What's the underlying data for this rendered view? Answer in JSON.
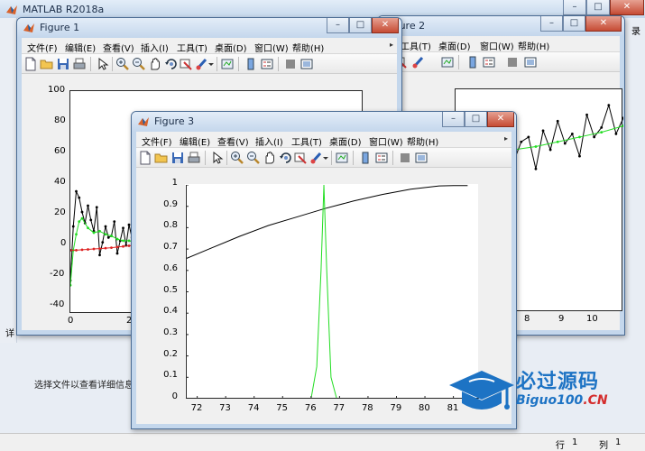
{
  "app": {
    "title": "MATLAB R2018a",
    "controls": {
      "minimize": "–",
      "maximize": "□",
      "close": "✕"
    },
    "side_text": "录",
    "browser_truncated": "详",
    "browser_hint": "选择文件以查看详细信息",
    "status": {
      "row_label": "行",
      "row_value": "1",
      "col_label": "列",
      "col_value": "1"
    }
  },
  "menus": [
    "文件(F)",
    "编辑(E)",
    "查看(V)",
    "插入(I)",
    "工具(T)",
    "桌面(D)",
    "窗口(W)",
    "帮助(H)"
  ],
  "icons": [
    "new-figure-icon",
    "open-file-icon",
    "save-icon",
    "print-icon",
    "select-arrow-icon",
    "zoom-in-icon",
    "zoom-out-icon",
    "pan-hand-icon",
    "rotate-3d-icon",
    "data-cursor-icon",
    "brush-icon",
    "link-plot-icon",
    "colorbar-icon",
    "legend-icon",
    "hide-plot-tools-icon",
    "show-plot-tools-icon"
  ],
  "figures": {
    "fig1": {
      "title": "Figure 1"
    },
    "fig2": {
      "title": "Figure 2"
    },
    "fig3": {
      "title": "Figure 3"
    }
  },
  "chart_data": [
    {
      "id": "figure-1-left-axes",
      "type": "line",
      "xlim": [
        0,
        10
      ],
      "ylim": [
        -40,
        100
      ],
      "x_ticks": [
        "0",
        "2"
      ],
      "y_ticks": [
        "-40",
        "-20",
        "0",
        "20",
        "40",
        "60",
        "80",
        "100"
      ],
      "grid": false,
      "series": [
        {
          "color": "#000000",
          "marker": "dot",
          "x": [
            0,
            0.1,
            0.2,
            0.3,
            0.4,
            0.5,
            0.6,
            0.7,
            0.8,
            0.9,
            1.0,
            1.1,
            1.2,
            1.3,
            1.4,
            1.5,
            1.6,
            1.7,
            1.8,
            1.9,
            2.0,
            2.1,
            2.2,
            2.3
          ],
          "y": [
            -19,
            15,
            37,
            33,
            24,
            17,
            28,
            19,
            12,
            27,
            -3,
            5,
            15,
            8,
            9,
            18,
            -2,
            6,
            14,
            3,
            16,
            8,
            5,
            4
          ]
        },
        {
          "color": "#22dd22",
          "marker": "dot",
          "x": [
            0,
            0.1,
            0.2,
            0.3,
            0.4,
            0.6,
            0.8,
            1.0,
            1.2,
            1.4,
            1.6,
            1.8,
            2.0,
            2.2,
            2.3
          ],
          "y": [
            -22,
            0,
            10,
            18,
            20,
            14,
            11,
            12,
            10,
            9,
            7,
            6,
            6,
            5,
            4
          ]
        },
        {
          "color": "#dd2222",
          "marker": "dot",
          "x": [
            0,
            0.2,
            0.4,
            0.6,
            0.8,
            1.0,
            1.2,
            1.4,
            1.6,
            1.8,
            2.0,
            2.2,
            2.3
          ],
          "y": [
            0,
            0,
            0.3,
            0.5,
            0.8,
            1,
            1.3,
            1.6,
            2,
            2.4,
            2.8,
            3.3,
            3.6
          ]
        }
      ]
    },
    {
      "id": "figure-2-right-axes",
      "type": "line",
      "xlim": [
        7.7,
        10
      ],
      "ylim": [
        -40,
        100
      ],
      "x_ticks": [
        "8",
        "9",
        "10"
      ],
      "grid": false,
      "series": [
        {
          "color": "#000000",
          "marker": "dot",
          "x": [
            7.9,
            8.0,
            8.1,
            8.2,
            8.3,
            8.4,
            8.5,
            8.6,
            8.7,
            8.8,
            8.9,
            9.0,
            9.1,
            9.2,
            9.3,
            9.4,
            9.5,
            9.6,
            9.7,
            9.8,
            9.9,
            10.0
          ],
          "y": [
            52,
            65,
            58,
            48,
            60,
            72,
            55,
            67,
            70,
            50,
            74,
            62,
            80,
            66,
            72,
            58,
            84,
            70,
            76,
            90,
            72,
            82
          ]
        },
        {
          "color": "#22dd22",
          "marker": "dot",
          "x": [
            7.9,
            8.2,
            8.5,
            8.8,
            9.1,
            9.4,
            9.7,
            10.0
          ],
          "y": [
            55,
            58,
            62,
            64,
            67,
            70,
            73,
            77
          ]
        }
      ]
    },
    {
      "id": "figure-3-axes",
      "type": "line",
      "xlim": [
        71.6,
        81.9
      ],
      "ylim": [
        0,
        1
      ],
      "x_ticks": [
        "72",
        "73",
        "74",
        "75",
        "76",
        "77",
        "78",
        "79",
        "80",
        "81"
      ],
      "y_ticks": [
        "0",
        "0.1",
        "0.2",
        "0.3",
        "0.4",
        "0.5",
        "0.6",
        "0.7",
        "0.8",
        "0.9",
        "1"
      ],
      "grid": false,
      "series": [
        {
          "color": "#000000",
          "x": [
            71.6,
            72.5,
            73.5,
            74.5,
            75.5,
            76.5,
            77.5,
            78.5,
            79.5,
            80.5,
            81,
            81.5
          ],
          "y": [
            0.655,
            0.705,
            0.76,
            0.81,
            0.85,
            0.89,
            0.925,
            0.955,
            0.98,
            0.995,
            0.997,
            0.997
          ]
        },
        {
          "color": "#22dd22",
          "x": [
            71.6,
            76.0,
            76.2,
            76.35,
            76.45,
            76.55,
            76.7,
            76.9,
            81.5
          ],
          "y": [
            0,
            0,
            0.15,
            0.6,
            1.0,
            0.6,
            0.1,
            0,
            0
          ]
        }
      ]
    }
  ],
  "watermark": {
    "cn": "必过源码",
    "en_prefix": "Biguo100",
    "en_suffix": ".CN"
  }
}
